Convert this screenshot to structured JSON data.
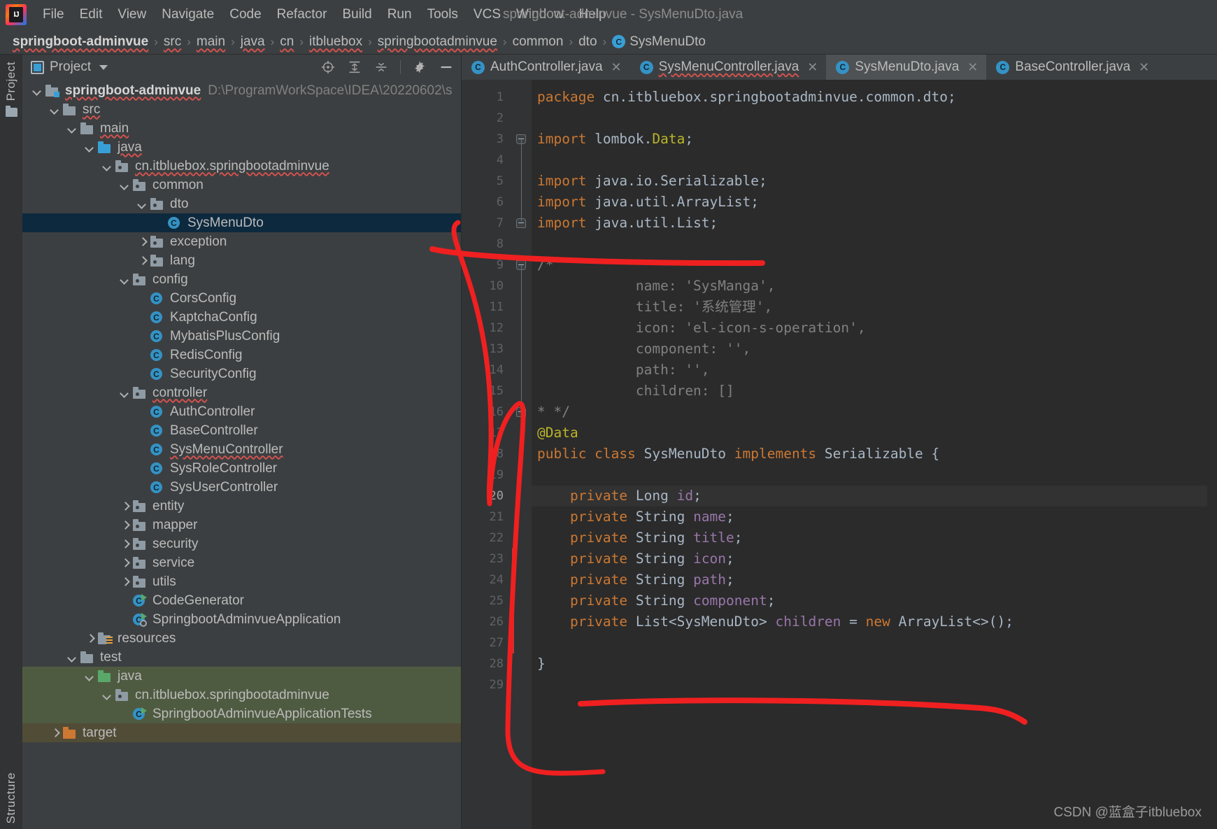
{
  "window": {
    "title": "springboot-adminvue - SysMenuDto.java",
    "app_icon": "intellij-idea-logo"
  },
  "menubar": {
    "items": [
      "File",
      "Edit",
      "View",
      "Navigate",
      "Code",
      "Refactor",
      "Build",
      "Run",
      "Tools",
      "VCS",
      "Window",
      "Help"
    ]
  },
  "breadcrumb": {
    "items": [
      {
        "label": "springboot-adminvue",
        "bold": true,
        "squiggle": true
      },
      {
        "label": "src",
        "squiggle": true
      },
      {
        "label": "main",
        "squiggle": true
      },
      {
        "label": "java",
        "squiggle": true
      },
      {
        "label": "cn",
        "squiggle": true
      },
      {
        "label": "itbluebox",
        "squiggle": true
      },
      {
        "label": "springbootadminvue",
        "squiggle": true
      },
      {
        "label": "common",
        "squiggle": false
      },
      {
        "label": "dto",
        "squiggle": false
      },
      {
        "label": "SysMenuDto",
        "icon": "class-icon",
        "squiggle": false
      }
    ],
    "separator": "›"
  },
  "toolstrip": {
    "project_label": "Project",
    "structure_label": "Structure",
    "folder_icon": "folder-icon"
  },
  "project_panel": {
    "title": "Project",
    "dropdown_icon": "chevron-down-icon",
    "actions": [
      "locate-icon",
      "expand-all-icon",
      "collapse-all-icon",
      "settings-gear-icon",
      "hide-icon"
    ],
    "tree": [
      {
        "depth": 0,
        "arrow": "down",
        "icon": "module",
        "label": "springboot-adminvue",
        "bold": true,
        "squiggle": true,
        "hint": "D:\\ProgramWorkSpace\\IDEA\\20220602\\s"
      },
      {
        "depth": 1,
        "arrow": "down",
        "icon": "folder",
        "label": "src",
        "squiggle": true
      },
      {
        "depth": 2,
        "arrow": "down",
        "icon": "folder",
        "label": "main",
        "squiggle": true
      },
      {
        "depth": 3,
        "arrow": "down",
        "icon": "folder-src",
        "label": "java",
        "squiggle": true
      },
      {
        "depth": 4,
        "arrow": "down",
        "icon": "pkg",
        "label": "cn.itbluebox.springbootadminvue",
        "squiggle": true
      },
      {
        "depth": 5,
        "arrow": "down",
        "icon": "pkg",
        "label": "common"
      },
      {
        "depth": 6,
        "arrow": "down",
        "icon": "pkg",
        "label": "dto"
      },
      {
        "depth": 7,
        "arrow": "none",
        "icon": "cls",
        "label": "SysMenuDto",
        "selected": true
      },
      {
        "depth": 6,
        "arrow": "right",
        "icon": "pkg",
        "label": "exception"
      },
      {
        "depth": 6,
        "arrow": "right",
        "icon": "pkg",
        "label": "lang"
      },
      {
        "depth": 5,
        "arrow": "down",
        "icon": "pkg",
        "label": "config"
      },
      {
        "depth": 6,
        "arrow": "none",
        "icon": "cls",
        "label": "CorsConfig"
      },
      {
        "depth": 6,
        "arrow": "none",
        "icon": "cls",
        "label": "KaptchaConfig"
      },
      {
        "depth": 6,
        "arrow": "none",
        "icon": "cls",
        "label": "MybatisPlusConfig"
      },
      {
        "depth": 6,
        "arrow": "none",
        "icon": "cls",
        "label": "RedisConfig"
      },
      {
        "depth": 6,
        "arrow": "none",
        "icon": "cls",
        "label": "SecurityConfig"
      },
      {
        "depth": 5,
        "arrow": "down",
        "icon": "pkg",
        "label": "controller",
        "squiggle": true
      },
      {
        "depth": 6,
        "arrow": "none",
        "icon": "cls",
        "label": "AuthController"
      },
      {
        "depth": 6,
        "arrow": "none",
        "icon": "cls",
        "label": "BaseController"
      },
      {
        "depth": 6,
        "arrow": "none",
        "icon": "cls",
        "label": "SysMenuController",
        "squiggle": true
      },
      {
        "depth": 6,
        "arrow": "none",
        "icon": "cls",
        "label": "SysRoleController"
      },
      {
        "depth": 6,
        "arrow": "none",
        "icon": "cls",
        "label": "SysUserController"
      },
      {
        "depth": 5,
        "arrow": "right",
        "icon": "pkg",
        "label": "entity"
      },
      {
        "depth": 5,
        "arrow": "right",
        "icon": "pkg",
        "label": "mapper"
      },
      {
        "depth": 5,
        "arrow": "right",
        "icon": "pkg",
        "label": "security"
      },
      {
        "depth": 5,
        "arrow": "right",
        "icon": "pkg",
        "label": "service"
      },
      {
        "depth": 5,
        "arrow": "right",
        "icon": "pkg",
        "label": "utils"
      },
      {
        "depth": 5,
        "arrow": "none",
        "icon": "cls-run",
        "label": "CodeGenerator"
      },
      {
        "depth": 5,
        "arrow": "none",
        "icon": "cls-spring",
        "label": "SpringbootAdminvueApplication"
      },
      {
        "depth": 3,
        "arrow": "right",
        "icon": "res",
        "label": "resources"
      },
      {
        "depth": 2,
        "arrow": "down",
        "icon": "folder",
        "label": "test"
      },
      {
        "depth": 3,
        "arrow": "down",
        "icon": "folder-green",
        "label": "java",
        "scope": "test"
      },
      {
        "depth": 4,
        "arrow": "down",
        "icon": "pkg",
        "label": "cn.itbluebox.springbootadminvue",
        "scope": "test"
      },
      {
        "depth": 5,
        "arrow": "none",
        "icon": "cls-run",
        "label": "SpringbootAdminvueApplicationTests",
        "scope": "test"
      },
      {
        "depth": 1,
        "arrow": "right",
        "icon": "folder-orange",
        "label": "target",
        "scope": "target"
      }
    ]
  },
  "editor": {
    "tabs": [
      {
        "label": "AuthController.java",
        "icon": "class-icon",
        "active": false,
        "closable": true,
        "squiggle": false
      },
      {
        "label": "SysMenuController.java",
        "icon": "class-icon",
        "active": false,
        "closable": true,
        "squiggle": true
      },
      {
        "label": "SysMenuDto.java",
        "icon": "class-icon",
        "active": true,
        "closable": true,
        "squiggle": false
      },
      {
        "label": "BaseController.java",
        "icon": "class-icon",
        "active": false,
        "closable": true,
        "squiggle": false
      }
    ],
    "current_line": 20,
    "lines": [
      {
        "n": 1,
        "segments": [
          {
            "t": "package ",
            "c": "k"
          },
          {
            "t": "cn.itbluebox.springbootadminvue.common.dto;",
            "c": "pkgc"
          }
        ],
        "fold": "",
        "indent": 0
      },
      {
        "n": 2,
        "segments": [],
        "fold": ""
      },
      {
        "n": 3,
        "segments": [
          {
            "t": "import ",
            "c": "k"
          },
          {
            "t": "lombok.",
            "c": "pkgc"
          },
          {
            "t": "Data",
            "c": "ann"
          },
          {
            "t": ";",
            "c": "pkgc"
          }
        ],
        "fold": "start"
      },
      {
        "n": 4,
        "segments": [],
        "fold": ""
      },
      {
        "n": 5,
        "segments": [
          {
            "t": "import ",
            "c": "k"
          },
          {
            "t": "java.io.Serializable;",
            "c": "pkgc"
          }
        ],
        "fold": ""
      },
      {
        "n": 6,
        "segments": [
          {
            "t": "import ",
            "c": "k"
          },
          {
            "t": "java.util.ArrayList;",
            "c": "pkgc"
          }
        ],
        "fold": ""
      },
      {
        "n": 7,
        "segments": [
          {
            "t": "import ",
            "c": "k"
          },
          {
            "t": "java.util.List;",
            "c": "pkgc"
          }
        ],
        "fold": "end"
      },
      {
        "n": 8,
        "segments": [],
        "fold": ""
      },
      {
        "n": 9,
        "segments": [
          {
            "t": "/*",
            "c": "cmt"
          }
        ],
        "fold": "start"
      },
      {
        "n": 10,
        "segments": [
          {
            "t": "            name: 'SysManga',",
            "c": "cmt"
          }
        ],
        "fold": ""
      },
      {
        "n": 11,
        "segments": [
          {
            "t": "            title: '系统管理',",
            "c": "cmt"
          }
        ],
        "fold": ""
      },
      {
        "n": 12,
        "segments": [
          {
            "t": "            icon: 'el-icon-s-operation',",
            "c": "cmt"
          }
        ],
        "fold": ""
      },
      {
        "n": 13,
        "segments": [
          {
            "t": "            component: '',",
            "c": "cmt"
          }
        ],
        "fold": ""
      },
      {
        "n": 14,
        "segments": [
          {
            "t": "            path: '',",
            "c": "cmt"
          }
        ],
        "fold": ""
      },
      {
        "n": 15,
        "segments": [
          {
            "t": "            children: []",
            "c": "cmt"
          }
        ],
        "fold": ""
      },
      {
        "n": 16,
        "segments": [
          {
            "t": "* */",
            "c": "cmt"
          }
        ],
        "fold": "end"
      },
      {
        "n": 17,
        "segments": [
          {
            "t": "@Data",
            "c": "ann"
          }
        ],
        "fold": ""
      },
      {
        "n": 18,
        "segments": [
          {
            "t": "public class ",
            "c": "k"
          },
          {
            "t": "SysMenuDto ",
            "c": "typ"
          },
          {
            "t": "implements ",
            "c": "k"
          },
          {
            "t": "Serializable {",
            "c": "typ"
          }
        ],
        "fold": ""
      },
      {
        "n": 19,
        "segments": [],
        "fold": ""
      },
      {
        "n": 20,
        "segments": [
          {
            "t": "    private ",
            "c": "k"
          },
          {
            "t": "Long ",
            "c": "typ"
          },
          {
            "t": "id",
            "c": "fld"
          },
          {
            "t": ";",
            "c": "typ"
          }
        ],
        "fold": "",
        "current": true
      },
      {
        "n": 21,
        "segments": [
          {
            "t": "    private ",
            "c": "k"
          },
          {
            "t": "String ",
            "c": "typ"
          },
          {
            "t": "name",
            "c": "fld"
          },
          {
            "t": ";",
            "c": "typ"
          }
        ],
        "fold": ""
      },
      {
        "n": 22,
        "segments": [
          {
            "t": "    private ",
            "c": "k"
          },
          {
            "t": "String ",
            "c": "typ"
          },
          {
            "t": "title",
            "c": "fld"
          },
          {
            "t": ";",
            "c": "typ"
          }
        ],
        "fold": ""
      },
      {
        "n": 23,
        "segments": [
          {
            "t": "    private ",
            "c": "k"
          },
          {
            "t": "String ",
            "c": "typ"
          },
          {
            "t": "icon",
            "c": "fld"
          },
          {
            "t": ";",
            "c": "typ"
          }
        ],
        "fold": ""
      },
      {
        "n": 24,
        "segments": [
          {
            "t": "    private ",
            "c": "k"
          },
          {
            "t": "String ",
            "c": "typ"
          },
          {
            "t": "path",
            "c": "fld"
          },
          {
            "t": ";",
            "c": "typ"
          }
        ],
        "fold": ""
      },
      {
        "n": 25,
        "segments": [
          {
            "t": "    private ",
            "c": "k"
          },
          {
            "t": "String ",
            "c": "typ"
          },
          {
            "t": "component",
            "c": "fld"
          },
          {
            "t": ";",
            "c": "typ"
          }
        ],
        "fold": ""
      },
      {
        "n": 26,
        "segments": [
          {
            "t": "    private ",
            "c": "k"
          },
          {
            "t": "List<SysMenuDto> ",
            "c": "typ"
          },
          {
            "t": "children ",
            "c": "fld"
          },
          {
            "t": "= ",
            "c": "typ"
          },
          {
            "t": "new ",
            "c": "k"
          },
          {
            "t": "ArrayList<>();",
            "c": "typ"
          }
        ],
        "fold": ""
      },
      {
        "n": 27,
        "segments": [],
        "fold": ""
      },
      {
        "n": 28,
        "segments": [
          {
            "t": "}",
            "c": "typ"
          }
        ],
        "fold": ""
      },
      {
        "n": 29,
        "segments": [],
        "fold": ""
      }
    ]
  },
  "watermark": {
    "text": "CSDN @蓝盒子itbluebox"
  },
  "annotations": {
    "color": "#f02020",
    "marks": [
      "underline-sysmenudto-tree-row",
      "curve-connector",
      "underline-children-field"
    ]
  },
  "colors": {
    "background": "#3c3f41",
    "editor_background": "#2b2b2b",
    "selection": "#0d293e",
    "accent": "#389fd6",
    "keyword": "#cc7832",
    "annotation": "#bbb529",
    "field": "#9876aa",
    "comment": "#808080",
    "test_scope": "#4f5b41",
    "target_scope": "#514c36",
    "mark": "#f02020"
  }
}
